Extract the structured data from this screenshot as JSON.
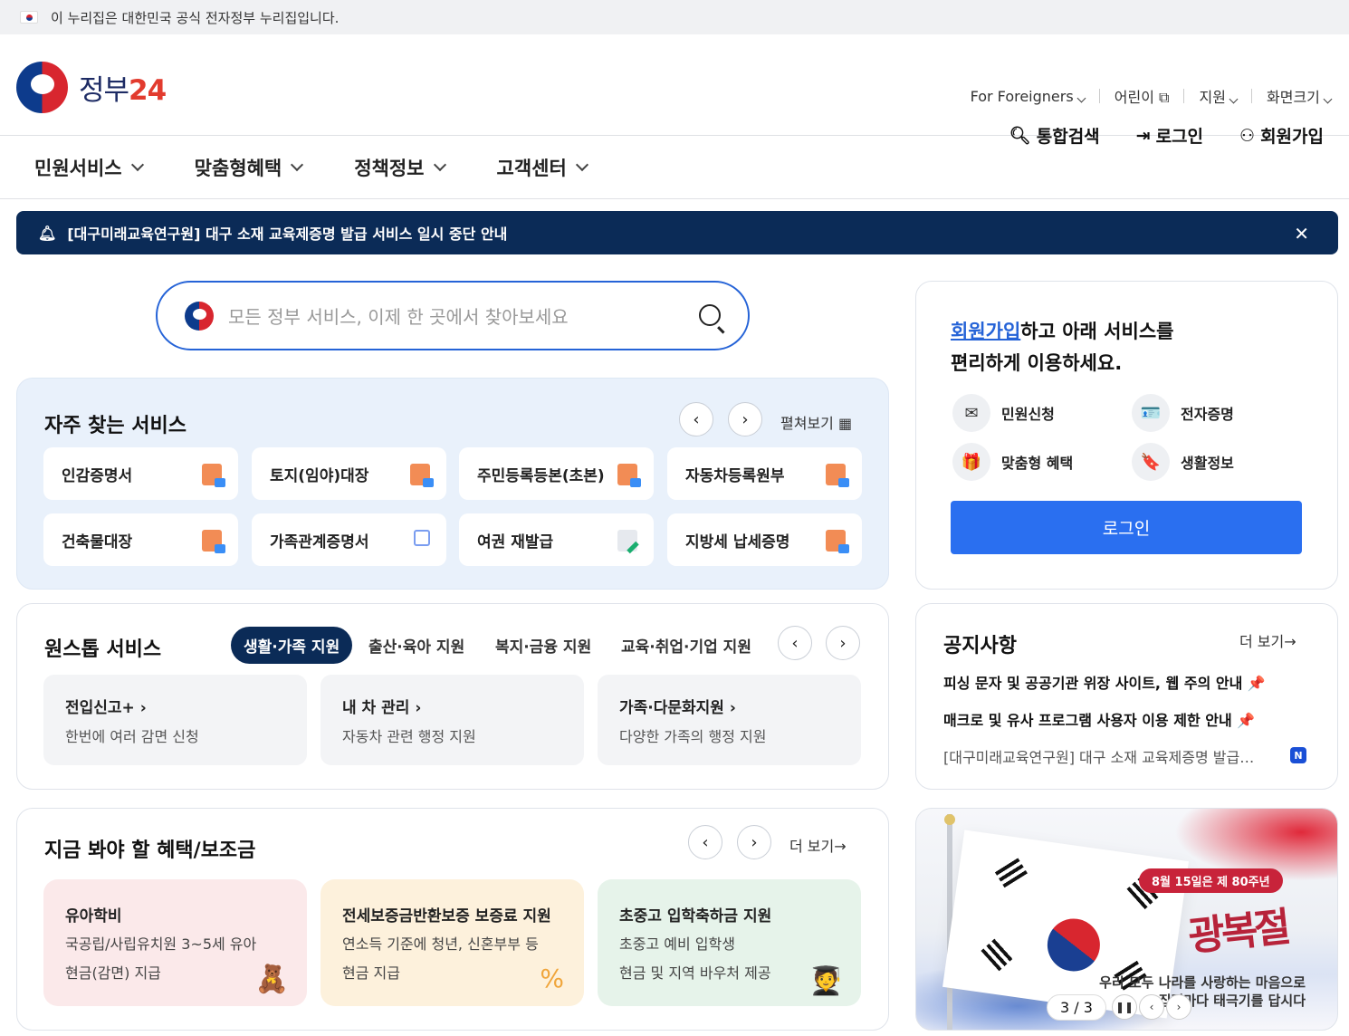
{
  "gov_banner": {
    "text": "이 누리집은 대한민국 공식 전자정부 누리집입니다."
  },
  "logo": {
    "name": "정부",
    "number": "24"
  },
  "util_links": [
    {
      "label": "For Foreigners"
    },
    {
      "label": "어린이"
    },
    {
      "label": "지원"
    },
    {
      "label": "화면크기"
    }
  ],
  "main_actions": {
    "search": "통합검색",
    "login": "로그인",
    "signup": "회원가입"
  },
  "nav": [
    "민원서비스",
    "맞춤형혜택",
    "정책정보",
    "고객센터"
  ],
  "notice_bar": {
    "text": "[대구미래교육연구원] 대구 소재 교육제증명 발급 서비스 일시 중단 안내"
  },
  "search": {
    "placeholder": "모든 정부 서비스, 이제 한 곳에서 찾아보세요"
  },
  "frequent": {
    "title": "자주 찾는 서비스",
    "expand": "펼쳐보기",
    "items": [
      "인감증명서",
      "토지(임야)대장",
      "주민등록등본(초본)",
      "자동차등록원부",
      "건축물대장",
      "가족관계증명서",
      "여권 재발급",
      "지방세 납세증명"
    ]
  },
  "onestop": {
    "title": "원스톱 서비스",
    "tabs": [
      "생활·가족 지원",
      "출산·육아 지원",
      "복지·금융 지원",
      "교육·취업·기업 지원"
    ],
    "cards": [
      {
        "title": "전입신고+",
        "desc": "한번에 여러 감면 신청"
      },
      {
        "title": "내 차 관리",
        "desc": "자동차 관련 행정 지원"
      },
      {
        "title": "가족·다문화지원",
        "desc": "다양한 가족의 행정 지원"
      }
    ]
  },
  "benefits": {
    "title": "지금 봐야 할 혜택/보조금",
    "more": "더 보기",
    "cards": [
      {
        "title": "유아학비",
        "line1": "국공립/사립유치원 3~5세 유아",
        "line2": "현금(감면) 지급"
      },
      {
        "title": "전세보증금반환보증 보증료 지원",
        "line1": "연소득 기준에 청년, 신혼부부 등",
        "line2": "현금 지급"
      },
      {
        "title": "초중고 입학축하금 지원",
        "line1": "초중고 예비 입학생",
        "line2": "현금 및 지역 바우처 제공"
      }
    ]
  },
  "login_panel": {
    "highlight": "회원가입",
    "msg1": "하고 아래 서비스를",
    "msg2": "편리하게 이용하세요.",
    "services": [
      "민원신청",
      "전자증명",
      "맞춤형 혜택",
      "생활정보"
    ],
    "button": "로그인"
  },
  "notices": {
    "title": "공지사항",
    "more": "더 보기",
    "items": [
      "피싱 문자 및 공공기관 위장 사이트, 웹 주의 안내",
      "매크로 및 유사 프로그램 사용자 이용 제한 안내",
      "[대구미래교육연구원] 대구 소재 교육제증명 발급…"
    ],
    "new_badge": "N"
  },
  "banner": {
    "pill": "8월 15일은 제 80주년",
    "title": "광복절",
    "sub1": "우리 모두 나라를 사랑하는 마음으로",
    "sub2": "집집마다 태극기를 답시다",
    "pager": "3 / 3"
  }
}
